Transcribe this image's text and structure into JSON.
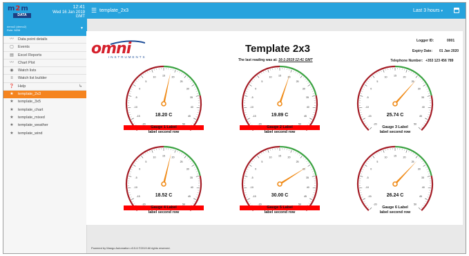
{
  "brand": {
    "logo_top": "m",
    "logo_top_accent": "2",
    "logo_top_end": "m",
    "logo_bottom": "DATA",
    "time": "12:41",
    "date": "Wed 16 Jan 2019",
    "tz": "GMT",
    "user_line1": "demo2 (demo2)",
    "user_line2": "Role: M2M"
  },
  "menu": [
    {
      "label": "Data point details",
      "icon": "chart-line-icon"
    },
    {
      "label": "Events",
      "icon": "events-icon"
    },
    {
      "label": "Excel Reports",
      "icon": "excel-icon"
    },
    {
      "label": "Chart Plot",
      "icon": "chart-line-icon"
    },
    {
      "label": "Watch lists",
      "icon": "eye-icon"
    },
    {
      "label": "Watch list builder",
      "icon": "list-builder-icon"
    },
    {
      "label": "Help",
      "icon": "help-icon"
    },
    {
      "label": "template_2x3",
      "icon": "star-icon",
      "active": true
    },
    {
      "label": "template_3x5",
      "icon": "star-icon"
    },
    {
      "label": "template_chart",
      "icon": "star-icon"
    },
    {
      "label": "template_mixed",
      "icon": "star-icon"
    },
    {
      "label": "template_weather",
      "icon": "star-icon"
    },
    {
      "label": "template_wind",
      "icon": "star-icon"
    }
  ],
  "topbar": {
    "title": "template_2x3",
    "range": "Last 3 hours",
    "range_caret": "▾"
  },
  "page": {
    "logo_word": "omni",
    "logo_sub": "INSTRUMENTS",
    "title": "Template 2x3",
    "last_reading_prefix": "The last reading was at:",
    "last_reading_value": "16-1-2019 12:41 GMT",
    "logger_id_label": "Logger ID:",
    "logger_id": "0001",
    "expiry_label": "Expiry Date:",
    "expiry": "01 Jan 2020",
    "phone_label": "Telephone Number:",
    "phone": "+353 123 456 789"
  },
  "gauge_scale": {
    "min": -20,
    "max": 50,
    "ticks": [
      "-20",
      "-15",
      "-10",
      "-5",
      "0",
      "5",
      "10",
      "15",
      "20",
      "25",
      "30",
      "35",
      "40",
      "45",
      "50"
    ]
  },
  "gauges": [
    {
      "value": 18.2,
      "value_text": "18.20 C",
      "label": "Gauge 1 Label",
      "label2": "label second row",
      "alarm": true
    },
    {
      "value": 19.89,
      "value_text": "19.89 C",
      "label": "Gauge 2 Label",
      "label2": "label second row",
      "alarm": true
    },
    {
      "value": 25.74,
      "value_text": "25.74 C",
      "label": "Gauge 3 Label",
      "label2": "label second row",
      "alarm": false
    },
    {
      "value": 18.52,
      "value_text": "18.52 C",
      "label": "Gauge 4 Label",
      "label2": "label second row",
      "alarm": true
    },
    {
      "value": 30.0,
      "value_text": "30.00 C",
      "label": "Gauge 5 Label",
      "label2": "label second row",
      "alarm": true
    },
    {
      "value": 26.24,
      "value_text": "26.24 C",
      "label": "Gauge 6 Label",
      "label2": "label second row",
      "alarm": false
    }
  ],
  "colors": {
    "primary": "#27a3dd",
    "active_menu": "#f5841f",
    "alarm": "#ff0000",
    "gauge_rim": "#a41c25",
    "gauge_green": "#3aa241",
    "needle": "#f08c1a"
  },
  "footer": "Powered by Mango Automation v3.5.6 ©2019 All rights reserved."
}
